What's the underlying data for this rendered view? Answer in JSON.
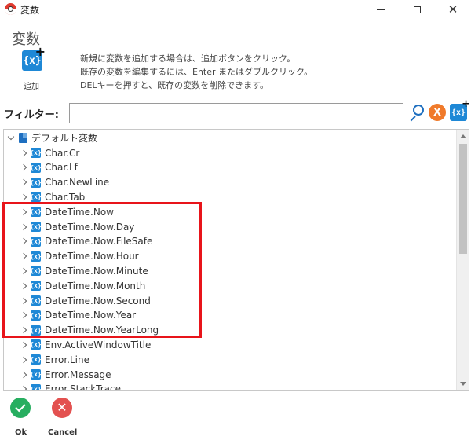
{
  "window": {
    "title": "変数",
    "close_glyph": "✕"
  },
  "header": {
    "title": "変数",
    "add_icon_glyph": "{x}",
    "add_label": "追加",
    "help_lines": [
      "新規に変数を追加する場合は、追加ボタンをクリック。",
      "既存の変数を編集するには、Enter またはダブルクリック。",
      "DELキーを押すと、既存の変数を削除できます。"
    ]
  },
  "filter": {
    "label": "フィルター:",
    "value": "",
    "clear_glyph": "X",
    "add_glyph": "{x}"
  },
  "tree": {
    "root_label": "デフォルト変数",
    "var_icon_glyph": "{x}",
    "items": [
      "Char.Cr",
      "Char.Lf",
      "Char.NewLine",
      "Char.Tab",
      "DateTime.Now",
      "DateTime.Now.Day",
      "DateTime.Now.FileSafe",
      "DateTime.Now.Hour",
      "DateTime.Now.Minute",
      "DateTime.Now.Month",
      "DateTime.Now.Second",
      "DateTime.Now.Year",
      "DateTime.Now.YearLong",
      "Env.ActiveWindowTitle",
      "Error.Line",
      "Error.Message",
      "Error.StackTrace"
    ]
  },
  "footer": {
    "ok_label": "Ok",
    "cancel_label": "Cancel",
    "cancel_glyph": "✕"
  },
  "colors": {
    "accent": "#1e88d6",
    "highlight": "#e8141a",
    "ok": "#27ae60",
    "cancel": "#e35150",
    "clear": "#f07a2a"
  }
}
